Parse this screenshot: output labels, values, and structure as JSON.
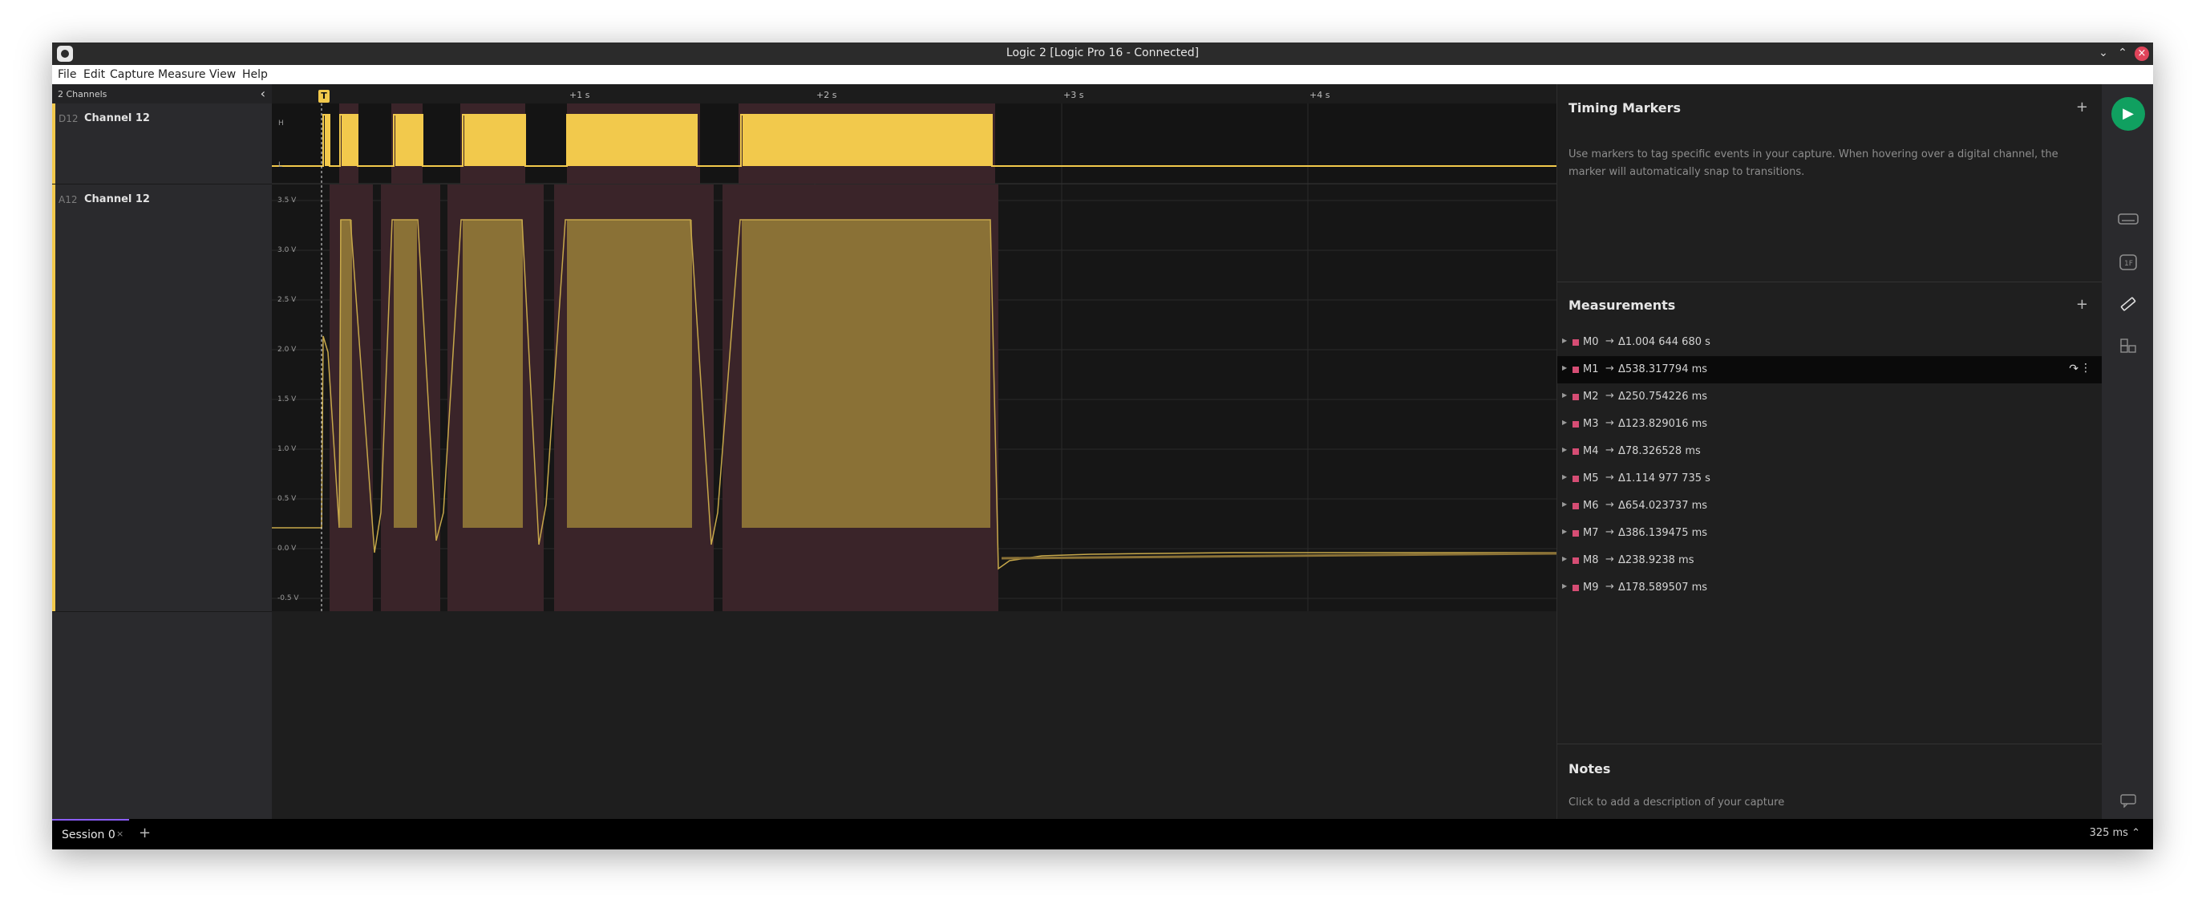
{
  "window": {
    "title": "Logic 2 [Logic Pro 16 - Connected]",
    "controls": {
      "minimize": "⌄",
      "maximize": "⌃",
      "close": "×"
    }
  },
  "menu": [
    "File",
    "Edit",
    "Capture",
    "Measure",
    "View",
    "Help"
  ],
  "channels": {
    "header": "2 Channels",
    "items": [
      {
        "tag": "D12",
        "name": "Channel 12"
      },
      {
        "tag": "A12",
        "name": "Channel 12"
      }
    ]
  },
  "timeline": {
    "marker_label": "T",
    "ticks": [
      "+1 s",
      "+2 s",
      "+3 s",
      "+4 s"
    ],
    "digital_levels": [
      "H",
      "L"
    ],
    "analog_ticks": [
      "3.5 V",
      "3.0 V",
      "2.5 V",
      "2.0 V",
      "1.5 V",
      "1.0 V",
      "0.5 V",
      "0.0 V",
      "-0.5 V"
    ]
  },
  "timing_markers": {
    "title": "Timing Markers",
    "add": "+",
    "hint": "Use markers to tag specific events in your capture. When hovering over a digital channel, the marker will automatically snap to transitions."
  },
  "measurements": {
    "title": "Measurements",
    "add": "+",
    "arrow": "→",
    "items": [
      {
        "name": "M0",
        "value": "Δ1.004 644 680 s"
      },
      {
        "name": "M1",
        "value": "Δ538.317794 ms"
      },
      {
        "name": "M2",
        "value": "Δ250.754226 ms"
      },
      {
        "name": "M3",
        "value": "Δ123.829016 ms"
      },
      {
        "name": "M4",
        "value": "Δ78.326528 ms"
      },
      {
        "name": "M5",
        "value": "Δ1.114 977 735 s"
      },
      {
        "name": "M6",
        "value": "Δ654.023737 ms"
      },
      {
        "name": "M7",
        "value": "Δ386.139475 ms"
      },
      {
        "name": "M8",
        "value": "Δ238.9238 ms"
      },
      {
        "name": "M9",
        "value": "Δ178.589507 ms"
      }
    ],
    "selected_index": 1
  },
  "notes": {
    "title": "Notes",
    "hint": "Click to add a description of your capture"
  },
  "session": {
    "tab": "Session 0",
    "close": "×",
    "add": "+",
    "zoom": "325 ms ⌃"
  },
  "colors": {
    "digital": "#f2c94c",
    "analog": "#8a7136",
    "measure_region": "#3a2429",
    "marker_red": "#d64d74",
    "play": "#10a060",
    "accent": "#8a5cf6"
  },
  "icons": {
    "play": "play-icon",
    "device": "device-settings-icon",
    "analyzers": "analyzers-icon",
    "measure": "ruler-icon",
    "extensions": "extensions-icon",
    "chat": "chat-icon",
    "menu": "menu-icon"
  }
}
